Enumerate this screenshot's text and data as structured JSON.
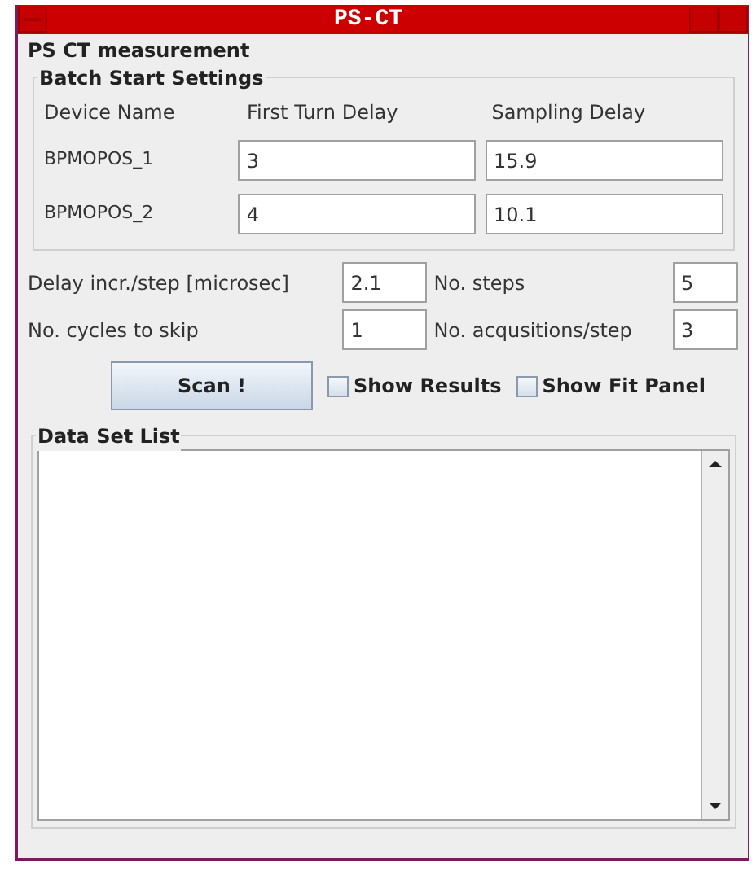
{
  "window": {
    "title": "PS-CT"
  },
  "panel": {
    "title": "PS CT measurement"
  },
  "batch": {
    "title": "Batch Start Settings",
    "columns": [
      "Device Name",
      "First Turn Delay",
      "Sampling Delay"
    ],
    "rows": [
      {
        "device": "BPMOPOS_1",
        "first_turn_delay": "3",
        "sampling_delay": "15.9"
      },
      {
        "device": "BPMOPOS_2",
        "first_turn_delay": "4",
        "sampling_delay": "10.1"
      }
    ]
  },
  "params": [
    {
      "label": "Delay incr./step [microsec]",
      "value": "2.1",
      "label_2": "No. steps",
      "value_2": "5"
    },
    {
      "label": "No. cycles to skip",
      "value": "1",
      "label_2": "No. acqusitions/step",
      "value_2": "3"
    }
  ],
  "scan_button": "Scan !",
  "checkboxes": [
    {
      "label": "Show Results",
      "checked": false
    },
    {
      "label": "Show Fit Panel",
      "checked": false
    }
  ],
  "data_set_list": {
    "title": "Data Set List"
  }
}
